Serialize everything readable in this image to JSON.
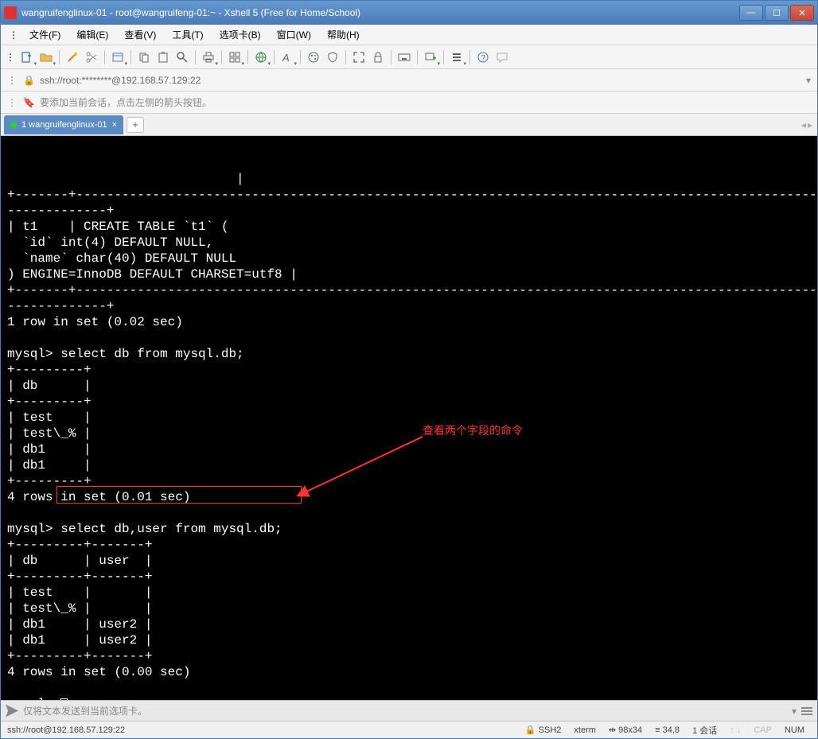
{
  "title": "wangruifenglinux-01 - root@wangruifeng-01:~ - Xshell 5 (Free for Home/School)",
  "menus": {
    "file": "文件(F)",
    "edit": "编辑(E)",
    "view": "查看(V)",
    "tools": "工具(T)",
    "tabs": "选项卡(B)",
    "window": "窗口(W)",
    "help": "帮助(H)"
  },
  "address": "ssh://root:********@192.168.57.129:22",
  "hint": "要添加当前会话，点击左侧的箭头按钮。",
  "tab": {
    "label": "1 wangruifenglinux-01",
    "close": "×",
    "new": "+"
  },
  "terminal_lines": [
    "                              |",
    "+-------+-----------------------------------------------------------------------------------------------------------",
    "-------------+",
    "| t1    | CREATE TABLE `t1` (",
    "  `id` int(4) DEFAULT NULL,",
    "  `name` char(40) DEFAULT NULL",
    ") ENGINE=InnoDB DEFAULT CHARSET=utf8 |",
    "+-------+-----------------------------------------------------------------------------------------------------------",
    "-------------+",
    "1 row in set (0.02 sec)",
    "",
    "mysql> select db from mysql.db;",
    "+---------+",
    "| db      |",
    "+---------+",
    "| test    |",
    "| test\\_% |",
    "| db1     |",
    "| db1     |",
    "+---------+",
    "4 rows in set (0.01 sec)",
    "",
    "mysql> select db,user from mysql.db;",
    "+---------+-------+",
    "| db      | user  |",
    "+---------+-------+",
    "| test    |       |",
    "| test\\_% |       |",
    "| db1     | user2 |",
    "| db1     | user2 |",
    "+---------+-------+",
    "4 rows in set (0.00 sec)",
    "",
    "mysql> "
  ],
  "annotation_text": "查看两个字段的命令",
  "inputbar_text": "仅将文本发送到当前选项卡。",
  "status": {
    "left": "ssh://root@192.168.57.129:22",
    "ssh": "SSH2",
    "term": "xterm",
    "size": "98x34",
    "pos": "34,8",
    "sess": "1 会话",
    "cap": "CAP",
    "num": "NUM",
    "size_icon": "⇹",
    "pos_icon": "≡"
  }
}
